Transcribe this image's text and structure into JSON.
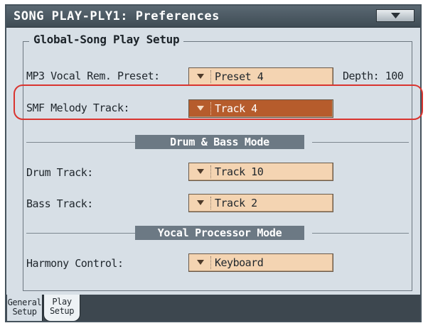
{
  "title": "SONG PLAY-PLY1: Preferences",
  "icons": {
    "menu": "triangle-down-icon",
    "dropdown_arrow": "triangle-down-icon"
  },
  "colors": {
    "titlebar": "#46535d",
    "panel": "#d7dfe6",
    "dropdown": "#f4d4b2",
    "dropdown_selected": "#b65c2c",
    "section_header": "#6c7984",
    "highlight_ring": "#d9342f"
  },
  "global": {
    "title": "Global-Song Play Setup",
    "mp3_vocal": {
      "label": "MP3 Vocal Rem. Preset:",
      "value": "Preset 4",
      "depth_label": "Depth: 100"
    },
    "smf_melody": {
      "label": "SMF Melody Track:",
      "value": "Track 4"
    }
  },
  "drum_bass": {
    "title": "Drum & Bass Mode",
    "drum": {
      "label": "Drum Track:",
      "value": "Track 10"
    },
    "bass": {
      "label": "Bass Track:",
      "value": "Track 2"
    }
  },
  "vocal": {
    "title": "Yocal Processor Mode",
    "harmony": {
      "label": "Harmony Control:",
      "value": "Keyboard"
    }
  },
  "tabs": {
    "general": {
      "line1": "General",
      "line2": "Setup"
    },
    "play": {
      "line1": "Play",
      "line2": "Setup"
    }
  }
}
